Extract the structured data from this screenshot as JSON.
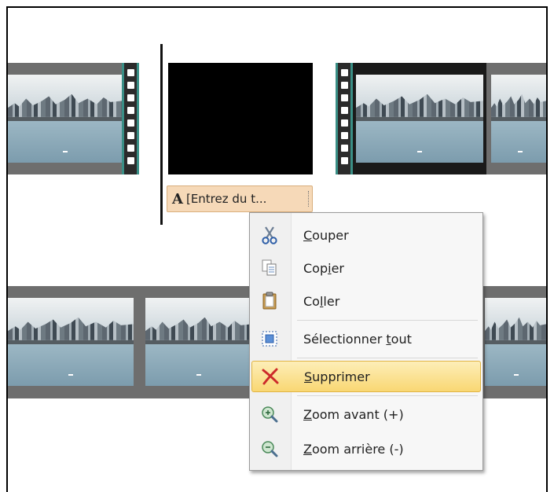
{
  "timeline": {
    "text_clip_label": "[Entrez du t...",
    "text_clip_icon": "A"
  },
  "context_menu": {
    "items": [
      {
        "label_pre": "",
        "label_key": "C",
        "label_post": "ouper",
        "icon": "scissors-icon"
      },
      {
        "label_pre": "Cop",
        "label_key": "i",
        "label_post": "er",
        "icon": "copy-icon"
      },
      {
        "label_pre": "Co",
        "label_key": "l",
        "label_post": "ler",
        "icon": "paste-icon"
      },
      {
        "label_pre": "Sélectionner ",
        "label_key": "t",
        "label_post": "out",
        "icon": "select-all-icon"
      },
      {
        "label_pre": "",
        "label_key": "S",
        "label_post": "upprimer",
        "icon": "delete-icon"
      },
      {
        "label_pre": "",
        "label_key": "Z",
        "label_post": "oom avant (+)",
        "icon": "zoom-in-icon"
      },
      {
        "label_pre": "",
        "label_key": "Z",
        "label_post": "oom arrière (-)",
        "icon": "zoom-out-icon"
      }
    ],
    "highlighted": "Supprimer"
  },
  "colors": {
    "highlight": "#f9d773",
    "delete_icon": "#cc2a2a",
    "text_clip": "#f6d9b8",
    "perforation_edge": "#3a8f86"
  }
}
